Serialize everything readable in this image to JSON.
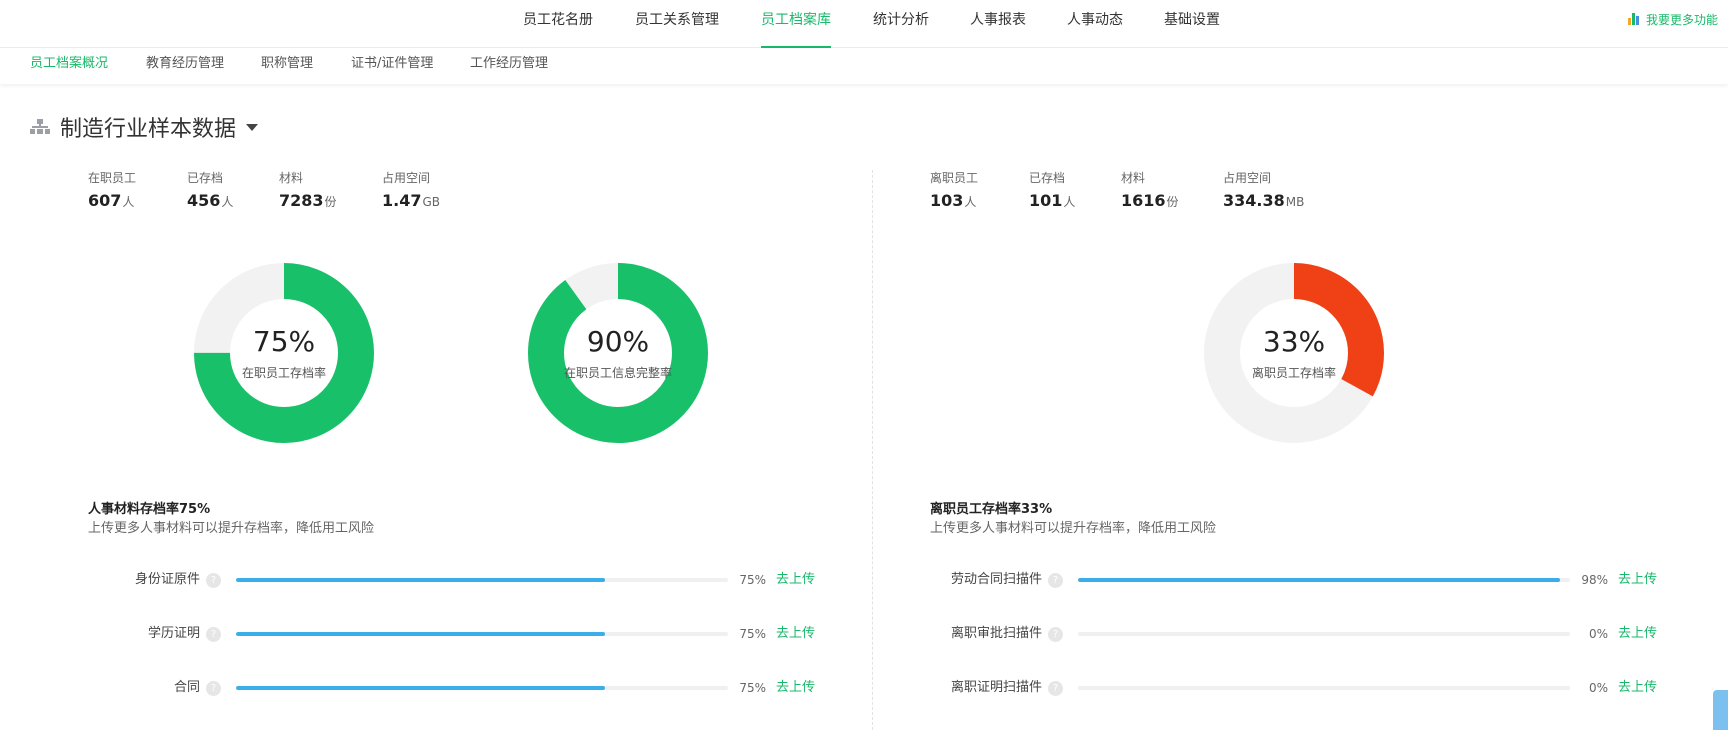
{
  "topnav": {
    "tabs": [
      "员工花名册",
      "员工关系管理",
      "员工档案库",
      "统计分析",
      "人事报表",
      "人事动态",
      "基础设置"
    ],
    "active_index": 2,
    "more_label": "我要更多功能"
  },
  "subnav": {
    "tabs": [
      "员工档案概况",
      "教育经历管理",
      "职称管理",
      "证书/证件管理",
      "工作经历管理"
    ],
    "active_index": 0
  },
  "section_title": "制造行业样本数据",
  "left": {
    "stats": [
      {
        "label": "在职员工",
        "value": "607",
        "unit": "人"
      },
      {
        "label": "已存档",
        "value": "456",
        "unit": "人"
      },
      {
        "label": "材料",
        "value": "7283",
        "unit": "份"
      },
      {
        "label": "占用空间",
        "value": "1.47",
        "unit": "GB"
      }
    ],
    "donuts": [
      {
        "pct_text": "75%",
        "caption": "在职员工存档率",
        "value": 0.75,
        "color": "#19c06a"
      },
      {
        "pct_text": "90%",
        "caption": "在职员工信息完整率",
        "value": 0.9,
        "color": "#19c06a"
      }
    ],
    "info_title": "人事材料存档率75%",
    "info_desc": "上传更多人事材料可以提升存档率，降低用工风险",
    "rows": [
      {
        "name": "身份证原件",
        "value": 0.75,
        "pct_text": "75%",
        "action": "去上传"
      },
      {
        "name": "学历证明",
        "value": 0.75,
        "pct_text": "75%",
        "action": "去上传"
      },
      {
        "name": "合同",
        "value": 0.75,
        "pct_text": "75%",
        "action": "去上传"
      }
    ]
  },
  "right": {
    "stats": [
      {
        "label": "离职员工",
        "value": "103",
        "unit": "人"
      },
      {
        "label": "已存档",
        "value": "101",
        "unit": "人"
      },
      {
        "label": "材料",
        "value": "1616",
        "unit": "份"
      },
      {
        "label": "占用空间",
        "value": "334.38",
        "unit": "MB"
      }
    ],
    "donuts": [
      {
        "pct_text": "33%",
        "caption": "离职员工存档率",
        "value": 0.33,
        "color": "#f04016"
      }
    ],
    "info_title": "离职员工存档率33%",
    "info_desc": "上传更多人事材料可以提升存档率，降低用工风险",
    "rows": [
      {
        "name": "劳动合同扫描件",
        "value": 0.98,
        "pct_text": "98%",
        "action": "去上传"
      },
      {
        "name": "离职审批扫描件",
        "value": 0.0,
        "pct_text": "0%",
        "action": "去上传"
      },
      {
        "name": "离职证明扫描件",
        "value": 0.0,
        "pct_text": "0%",
        "action": "去上传"
      }
    ]
  },
  "colors": {
    "accent": "#19b96a",
    "progress": "#3aaee8",
    "track": "#f0f0f0",
    "ring_bg": "#f2f2f2"
  }
}
